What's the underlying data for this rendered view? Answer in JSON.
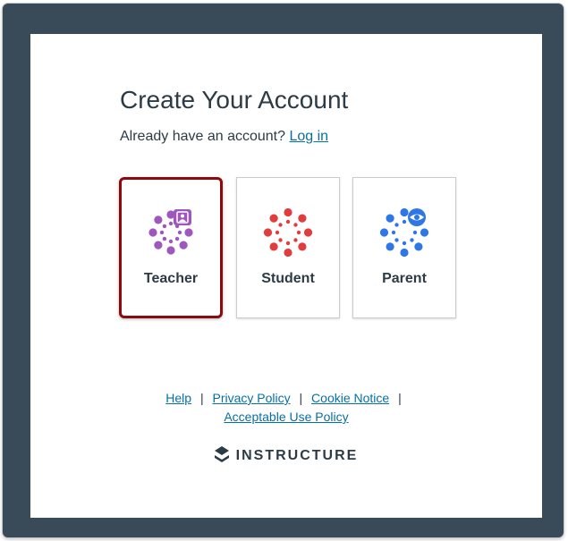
{
  "page": {
    "title": "Create Your Account",
    "already_prompt": "Already have an account?",
    "login_link": "Log in"
  },
  "roles": [
    {
      "label": "Teacher",
      "icon": "canvas-teacher-icon",
      "color": "#9e58bd",
      "selected": true
    },
    {
      "label": "Student",
      "icon": "canvas-student-icon",
      "color": "#e03e3e",
      "selected": false
    },
    {
      "label": "Parent",
      "icon": "canvas-parent-icon",
      "color": "#2f76e6",
      "selected": false
    }
  ],
  "footer": {
    "links": [
      "Help",
      "Privacy Policy",
      "Cookie Notice",
      "Acceptable Use Policy"
    ],
    "separator": "|"
  },
  "brand": {
    "name": "INSTRUCTURE",
    "icon": "instructure-logo-icon"
  },
  "colors": {
    "frame": "#394b58",
    "selected_border": "#8b0a0e",
    "link": "#0770a3",
    "text": "#2d3b45"
  }
}
